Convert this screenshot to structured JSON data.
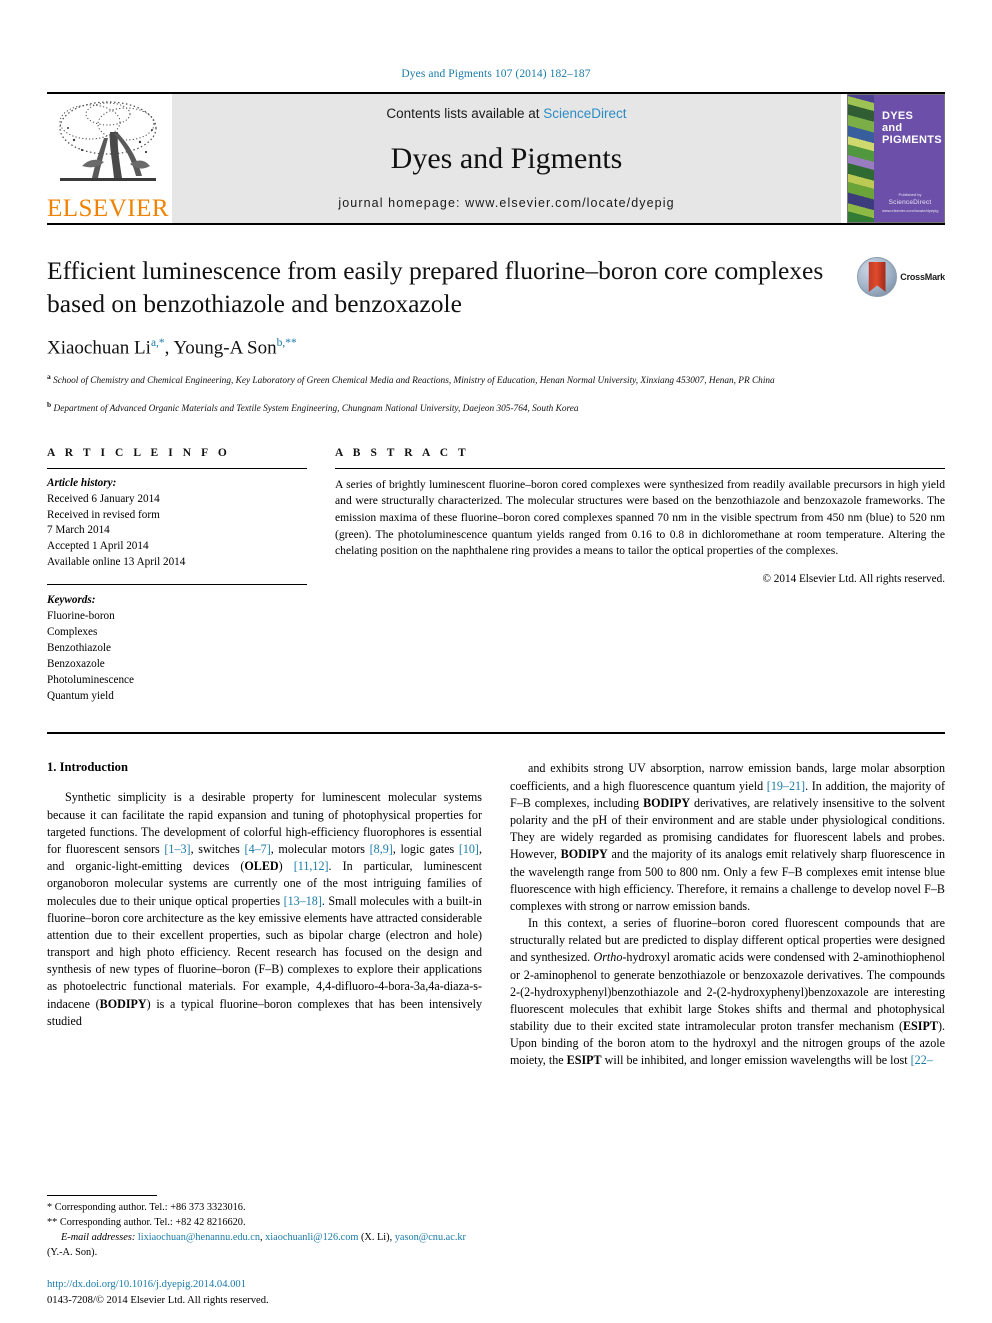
{
  "running_head": "Dyes and Pigments 107 (2014) 182–187",
  "masthead": {
    "publisher_name": "ELSEVIER",
    "contents_prefix": "Contents lists available at",
    "sciencedirect": "ScienceDirect",
    "journal_title": "Dyes and Pigments",
    "homepage": "journal homepage: www.elsevier.com/locate/dyepig",
    "cover": {
      "line1": "DYES",
      "line2": "and",
      "line3": "PIGMENTS",
      "publisher_note": "Published by",
      "publisher_mark": "ScienceDirect",
      "url_note": "www.elsevier.com/locate/dyepig"
    },
    "colors": {
      "link_blue": "#2b8cc4",
      "elsevier_orange": "#ef8200",
      "banner_gray": "#e6e6e6",
      "cover_purple": "#6b4fa8"
    }
  },
  "article": {
    "title": "Efficient luminescence from easily prepared fluorine–boron core complexes based on benzothiazole and benzoxazole",
    "crossmark_label": "CrossMark",
    "authors_html": "Xiaochuan Li<sup>a,</sup><sup>*</sup>, Young-A Son<sup>b,</sup><sup>**</sup>",
    "affiliations": [
      "a School of Chemistry and Chemical Engineering, Key Laboratory of Green Chemical Media and Reactions, Ministry of Education, Henan Normal University, Xinxiang 453007, Henan, PR China",
      "b Department of Advanced Organic Materials and Textile System Engineering, Chungnam National University, Daejeon 305-764, South Korea"
    ]
  },
  "article_info": {
    "heading": "A R T I C L E  I N F O",
    "history_label": "Article history:",
    "history": [
      "Received 6 January 2014",
      "Received in revised form",
      "7 March 2014",
      "Accepted 1 April 2014",
      "Available online 13 April 2014"
    ],
    "keywords_label": "Keywords:",
    "keywords": [
      "Fluorine-boron",
      "Complexes",
      "Benzothiazole",
      "Benzoxazole",
      "Photoluminescence",
      "Quantum yield"
    ]
  },
  "abstract": {
    "heading": "A B S T R A C T",
    "text": "A series of brightly luminescent fluorine–boron cored complexes were synthesized from readily available precursors in high yield and were structurally characterized. The molecular structures were based on the benzothiazole and benzoxazole frameworks. The emission maxima of these fluorine–boron cored complexes spanned 70 nm in the visible spectrum from 450 nm (blue) to 520 nm (green). The photoluminescence quantum yields ranged from 0.16 to 0.8 in dichloromethane at room temperature. Altering the chelating position on the naphthalene ring provides a means to tailor the optical properties of the complexes.",
    "copyright": "© 2014 Elsevier Ltd. All rights reserved."
  },
  "body": {
    "section_title": "1. Introduction",
    "left_para_1_html": "Synthetic simplicity is a desirable property for luminescent molecular systems because it can facilitate the rapid expansion and tuning of photophysical properties for targeted functions. The development of colorful high-efficiency fluorophores is essential for fluorescent sensors <span class=\"ref\">[1–3]</span>, switches <span class=\"ref\">[4–7]</span>, molecular motors <span class=\"ref\">[8,9]</span>, logic gates <span class=\"ref\">[10]</span>, and organic-light-emitting devices (<span class=\"bold\">OLED</span>) <span class=\"ref\">[11,12]</span>. In particular, luminescent organoboron molecular systems are currently one of the most intriguing families of molecules due to their unique optical properties <span class=\"ref\">[13–18]</span>. Small molecules with a built-in fluorine–boron core architecture as the key emissive elements have attracted considerable attention due to their excellent properties, such as bipolar charge (electron and hole) transport and high photo efficiency. Recent research has focused on the design and synthesis of new types of fluorine–boron (F–B) complexes to explore their applications as photoelectric functional materials. For example, 4,4-difluoro-4-bora-3a,4a-diaza-s-indacene (<span class=\"bold\">BODIPY</span>) is a typical fluorine–boron complexes that has been intensively studied",
    "right_para_1_html": "and exhibits strong UV absorption, narrow emission bands, large molar absorption coefficients, and a high fluorescence quantum yield <span class=\"ref\">[19–21]</span>. In addition, the majority of F–B complexes, including <span class=\"bold\">BODIPY</span> derivatives, are relatively insensitive to the solvent polarity and the pH of their environment and are stable under physiological conditions. They are widely regarded as promising candidates for fluorescent labels and probes. However, <span class=\"bold\">BODIPY</span> and the majority of its analogs emit relatively sharp fluorescence in the wavelength range from 500 to 800 nm. Only a few F–B complexes emit intense blue fluorescence with high efficiency. Therefore, it remains a challenge to develop novel F–B complexes with strong or narrow emission bands.",
    "right_para_2_html": "In this context, a series of fluorine–boron cored fluorescent compounds that are structurally related but are predicted to display different optical properties were designed and synthesized. <span style=\"font-style:italic\">Ortho</span>-hydroxyl aromatic acids were condensed with 2-aminothiophenol or 2-aminophenol to generate benzothiazole or benzoxazole derivatives. The compounds 2-(2-hydroxyphenyl)benzothiazole and 2-(2-hydroxyphenyl)benzoxazole are interesting fluorescent molecules that exhibit large Stokes shifts and thermal and photophysical stability due to their excited state intramolecular proton transfer mechanism (<span class=\"bold\">ESIPT</span>). Upon binding of the boron atom to the hydroxyl and the nitrogen groups of the azole moiety, the <span class=\"bold\">ESIPT</span> will be inhibited, and longer emission wavelengths will be lost <span class=\"ref\">[22–</span>"
  },
  "footnotes": {
    "line1": "* Corresponding author. Tel.: +86 373 3323016.",
    "line2": "** Corresponding author. Tel.: +82 42 8216620.",
    "email_label": "E-mail addresses:",
    "email1": "lixiaochuan@henannu.edu.cn",
    "email2": "xiaochuanli@126.com",
    "email1_owner": "(X. Li),",
    "email3": "yason@cnu.ac.kr",
    "email3_owner": "(Y.-A. Son).",
    "doi": "http://dx.doi.org/10.1016/j.dyepig.2014.04.001",
    "issn_line": "0143-7208/© 2014 Elsevier Ltd. All rights reserved."
  }
}
